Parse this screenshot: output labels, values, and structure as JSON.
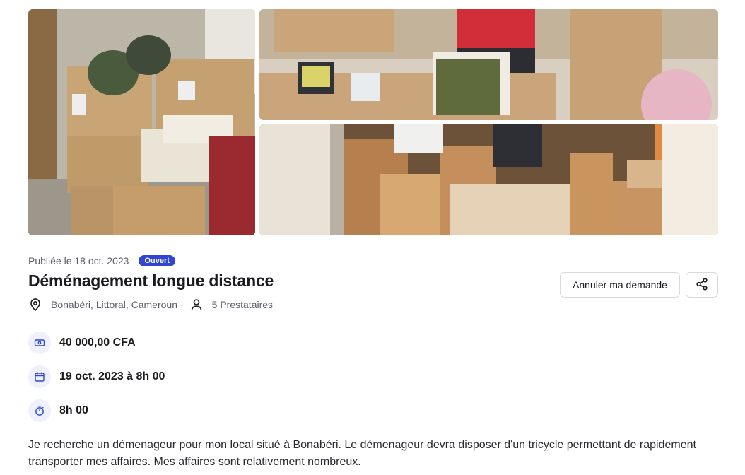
{
  "listing": {
    "published": "Publiée le 18 oct. 2023",
    "status": "Ouvert",
    "title": "Déménagement longue distance",
    "location": "Bonabéri, Littoral, Cameroun",
    "separator": "·",
    "providers": "5 Prestataires"
  },
  "actions": {
    "cancel_label": "Annuler ma demande",
    "share_icon": "share-icon"
  },
  "details": {
    "price": "40 000,00 CFA",
    "date": "19 oct. 2023 à 8h 00",
    "duration": "8h 00"
  },
  "description": "Je recherche un démenageur pour mon local situé à Bonabéri. Le démenageur devra disposer d'un tricycle permettant de rapidement transporter mes affaires. Mes affaires sont relativement nombreux.",
  "colors": {
    "accent": "#3246d3",
    "icon_bg": "#eef0fb",
    "muted_text": "#5b5e6a"
  }
}
